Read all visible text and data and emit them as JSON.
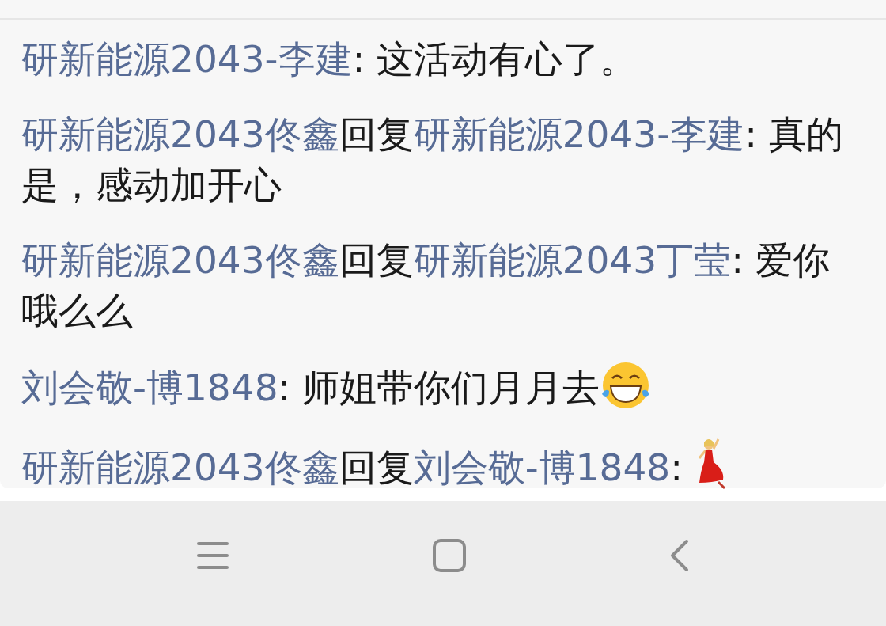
{
  "comments": [
    {
      "kind": "plain",
      "author": "研新能源2043-李建",
      "separator": ": ",
      "text": "这活动有心了。"
    },
    {
      "kind": "plain",
      "author": "研新能源2043佟鑫",
      "reply_word": "回复",
      "reply_to": "研新能源2043-李建",
      "separator": ": ",
      "text": "真的是，感动加开心"
    },
    {
      "kind": "plain",
      "author": "研新能源2043佟鑫",
      "reply_word": "回复",
      "reply_to": "研新能源2043丁莹",
      "separator": ": ",
      "text": "爱你哦么么"
    },
    {
      "kind": "laughing",
      "author": "刘会敬-博1848",
      "separator": ": ",
      "text": "师姐带你们月月去"
    },
    {
      "kind": "dancer",
      "author": "研新能源2043佟鑫",
      "reply_word": "回复",
      "reply_to": "刘会敬-博1848",
      "separator": ": "
    }
  ]
}
